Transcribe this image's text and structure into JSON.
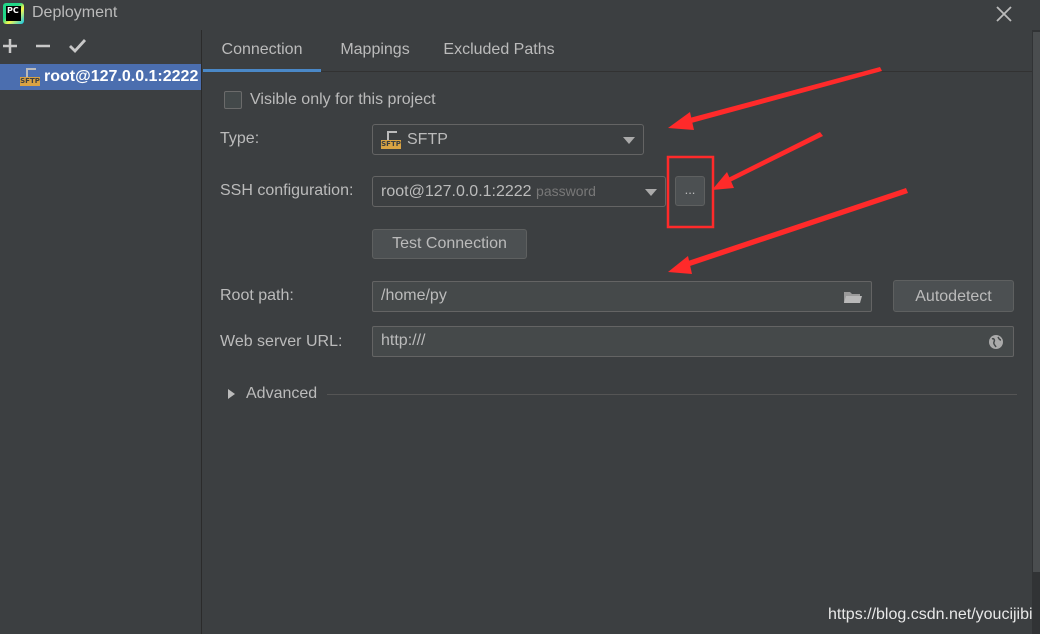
{
  "window": {
    "title": "Deployment",
    "app_icon_text": "PC"
  },
  "sidebar": {
    "toolbar": [
      "add",
      "remove",
      "apply"
    ],
    "items": [
      {
        "label": "root@127.0.0.1:2222",
        "icon": "sftp-icon",
        "badge_text": "SFTP",
        "selected": true
      }
    ]
  },
  "tabs": [
    {
      "label": "Connection",
      "active": true
    },
    {
      "label": "Mappings",
      "active": false
    },
    {
      "label": "Excluded Paths",
      "active": false
    }
  ],
  "form": {
    "visible_only_label": "Visible only for this project",
    "visible_only_checked": false,
    "type_label": "Type:",
    "type_value": "SFTP",
    "type_badge_text": "SFTP",
    "ssh_label": "SSH configuration:",
    "ssh_value": "root@127.0.0.1:2222",
    "ssh_hint": "password",
    "browse_label": "...",
    "test_connection_label": "Test Connection",
    "root_path_label": "Root path:",
    "root_path_value": "/home/py",
    "autodetect_label": "Autodetect",
    "web_url_label": "Web server URL:",
    "web_url_value": "http:///",
    "advanced_label": "Advanced"
  },
  "watermark": "https://blog.csdn.net/youcijibi",
  "colors": {
    "background": "#3c3f41",
    "selection": "#4b6eaf",
    "active_tab_underline": "#4a88c7",
    "annotation_red": "#ff2a2a"
  }
}
